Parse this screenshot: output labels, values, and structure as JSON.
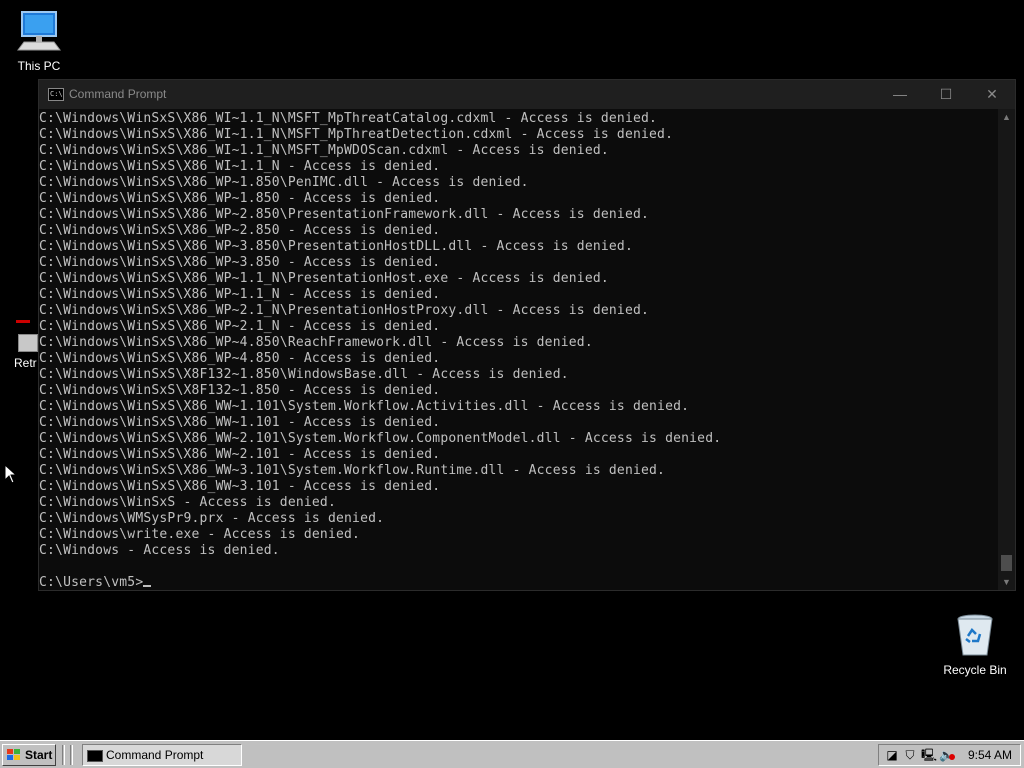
{
  "desktop": {
    "icons": {
      "this_pc": "This PC",
      "recycle_bin": "Recycle Bin",
      "partial_label": "Retr"
    }
  },
  "window": {
    "title": "Command Prompt",
    "icon_text": "C:\\",
    "buttons": {
      "minimize": "—",
      "maximize": "☐",
      "close": "✕"
    }
  },
  "terminal": {
    "lines": [
      "C:\\Windows\\WinSxS\\X86_WI~1.1_N\\MSFT_MpThreatCatalog.cdxml - Access is denied.",
      "C:\\Windows\\WinSxS\\X86_WI~1.1_N\\MSFT_MpThreatDetection.cdxml - Access is denied.",
      "C:\\Windows\\WinSxS\\X86_WI~1.1_N\\MSFT_MpWDOScan.cdxml - Access is denied.",
      "C:\\Windows\\WinSxS\\X86_WI~1.1_N - Access is denied.",
      "C:\\Windows\\WinSxS\\X86_WP~1.850\\PenIMC.dll - Access is denied.",
      "C:\\Windows\\WinSxS\\X86_WP~1.850 - Access is denied.",
      "C:\\Windows\\WinSxS\\X86_WP~2.850\\PresentationFramework.dll - Access is denied.",
      "C:\\Windows\\WinSxS\\X86_WP~2.850 - Access is denied.",
      "C:\\Windows\\WinSxS\\X86_WP~3.850\\PresentationHostDLL.dll - Access is denied.",
      "C:\\Windows\\WinSxS\\X86_WP~3.850 - Access is denied.",
      "C:\\Windows\\WinSxS\\X86_WP~1.1_N\\PresentationHost.exe - Access is denied.",
      "C:\\Windows\\WinSxS\\X86_WP~1.1_N - Access is denied.",
      "C:\\Windows\\WinSxS\\X86_WP~2.1_N\\PresentationHostProxy.dll - Access is denied.",
      "C:\\Windows\\WinSxS\\X86_WP~2.1_N - Access is denied.",
      "C:\\Windows\\WinSxS\\X86_WP~4.850\\ReachFramework.dll - Access is denied.",
      "C:\\Windows\\WinSxS\\X86_WP~4.850 - Access is denied.",
      "C:\\Windows\\WinSxS\\X8F132~1.850\\WindowsBase.dll - Access is denied.",
      "C:\\Windows\\WinSxS\\X8F132~1.850 - Access is denied.",
      "C:\\Windows\\WinSxS\\X86_WW~1.101\\System.Workflow.Activities.dll - Access is denied.",
      "C:\\Windows\\WinSxS\\X86_WW~1.101 - Access is denied.",
      "C:\\Windows\\WinSxS\\X86_WW~2.101\\System.Workflow.ComponentModel.dll - Access is denied.",
      "C:\\Windows\\WinSxS\\X86_WW~2.101 - Access is denied.",
      "C:\\Windows\\WinSxS\\X86_WW~3.101\\System.Workflow.Runtime.dll - Access is denied.",
      "C:\\Windows\\WinSxS\\X86_WW~3.101 - Access is denied.",
      "C:\\Windows\\WinSxS - Access is denied.",
      "C:\\Windows\\WMSysPr9.prx - Access is denied.",
      "C:\\Windows\\write.exe - Access is denied.",
      "C:\\Windows - Access is denied.",
      "",
      "C:\\Users\\vm5>"
    ]
  },
  "taskbar": {
    "start_label": "Start",
    "task_label": "Command Prompt",
    "clock": "9:54 AM"
  },
  "colors": {
    "terminal_bg": "#0c0c0c",
    "terminal_fg": "#c0c0c0",
    "taskbar_bg": "#c0c0c0"
  }
}
